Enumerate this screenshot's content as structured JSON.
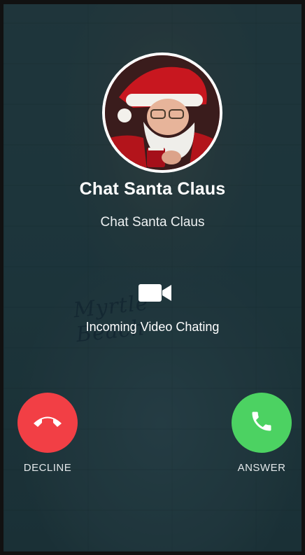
{
  "caller": {
    "name": "Chat Santa Claus",
    "subtitle": "Chat Santa Claus"
  },
  "call": {
    "status": "Incoming Video Chating",
    "type_icon": "video-camera-icon"
  },
  "background": {
    "sweater_text": "Myrtle Beach"
  },
  "actions": {
    "decline_label": "DECLINE",
    "answer_label": "ANSWER",
    "decline_icon": "phone-hangup-icon",
    "answer_icon": "phone-icon"
  },
  "colors": {
    "decline": "#f23f45",
    "answer": "#4cd262",
    "overlay": "#10282e"
  }
}
